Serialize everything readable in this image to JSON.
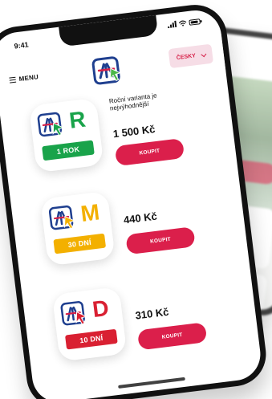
{
  "status": {
    "time": "9:41"
  },
  "header": {
    "menu_label": "MENU",
    "language_label": "ČESKY"
  },
  "products": [
    {
      "letter": "R",
      "badge": "1 ROK",
      "note": "Roční varianta je nejvýhodnější",
      "price": "1 500 Kč",
      "button": "KOUPIT",
      "color": "#19a34a"
    },
    {
      "letter": "M",
      "badge": "30 DNÍ",
      "price": "440 Kč",
      "button": "KOUPIT",
      "color": "#f3b000"
    },
    {
      "letter": "D",
      "badge": "10 DNÍ",
      "price": "310 Kč",
      "button": "KOUPIT",
      "color": "#d92032"
    }
  ],
  "colors": {
    "accent": "#db1f4b",
    "brand_blue": "#1f3f8f",
    "language_background": "#f6dde6"
  },
  "icons": {
    "brand": "highway-vignette-logo-icon",
    "menu": "hamburger-menu-icon",
    "language": "chevron-down-icon",
    "product": "highway-cursor-icon"
  }
}
